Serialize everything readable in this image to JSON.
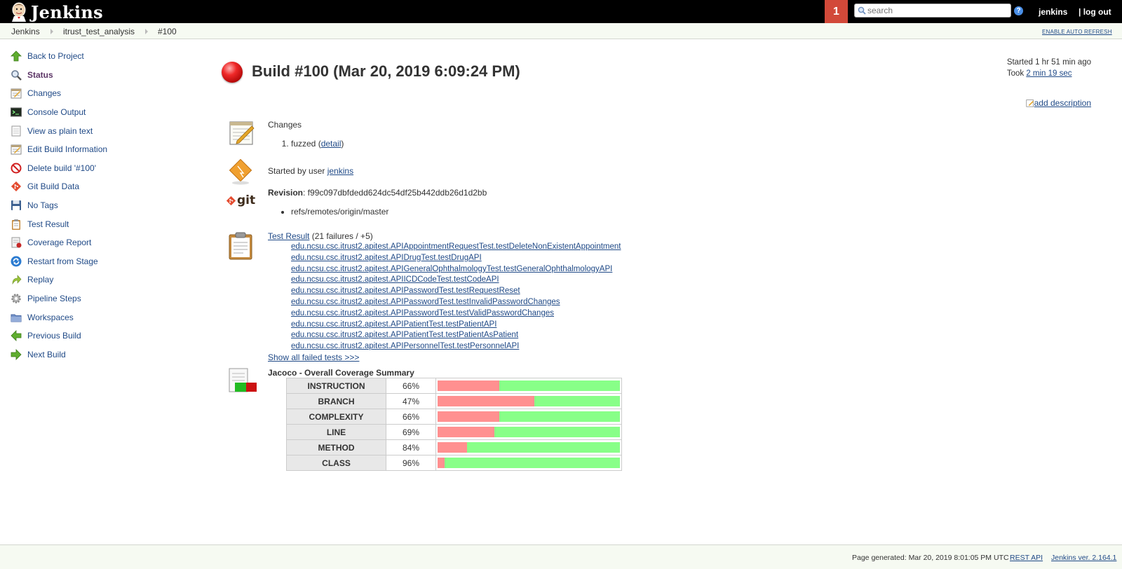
{
  "header": {
    "app_title": "Jenkins",
    "notification_count": "1",
    "search_placeholder": "search",
    "help": "?",
    "user": "jenkins",
    "logout": "| log out"
  },
  "breadcrumb": {
    "items": [
      "Jenkins",
      "itrust_test_analysis",
      "#100"
    ],
    "auto_refresh": "ENABLE AUTO REFRESH"
  },
  "sidebar": {
    "items": [
      {
        "label": "Back to Project",
        "icon": "up-arrow-icon"
      },
      {
        "label": "Status",
        "icon": "magnifier-icon"
      },
      {
        "label": "Changes",
        "icon": "notepad-icon"
      },
      {
        "label": "Console Output",
        "icon": "terminal-icon"
      },
      {
        "label": "View as plain text",
        "icon": "document-icon"
      },
      {
        "label": "Edit Build Information",
        "icon": "notepad-icon"
      },
      {
        "label": "Delete build '#100'",
        "icon": "no-entry-icon"
      },
      {
        "label": "Git Build Data",
        "icon": "git-icon"
      },
      {
        "label": "No Tags",
        "icon": "floppy-icon"
      },
      {
        "label": "Test Result",
        "icon": "clipboard-icon"
      },
      {
        "label": "Coverage Report",
        "icon": "coverage-icon"
      },
      {
        "label": "Restart from Stage",
        "icon": "refresh-icon"
      },
      {
        "label": "Replay",
        "icon": "replay-arrow-icon"
      },
      {
        "label": "Pipeline Steps",
        "icon": "gear-icon"
      },
      {
        "label": "Workspaces",
        "icon": "folder-icon"
      },
      {
        "label": "Previous Build",
        "icon": "left-arrow-icon"
      },
      {
        "label": "Next Build",
        "icon": "right-arrow-icon"
      }
    ]
  },
  "build": {
    "title": "Build #100 (Mar 20, 2019 6:09:24 PM)",
    "status_color": "#ef2929",
    "started": "Started 1 hr 51 min ago",
    "took_prefix": "Took ",
    "took": "2 min 19 sec",
    "add_description": "add description"
  },
  "changes": {
    "heading": "Changes",
    "item_text": "fuzzed (",
    "item_link": "detail",
    "item_suffix": ")"
  },
  "cause": {
    "prefix": "Started by user ",
    "user": "jenkins"
  },
  "git": {
    "logo_text": "git",
    "revision_label": "Revision",
    "revision_value": ": f99c097dbfdedd624dc54df25b442ddb26d1d2bb",
    "branch": "refs/remotes/origin/master"
  },
  "tests": {
    "link": "Test Result",
    "summary": " (21 failures / +5)",
    "failures": [
      "edu.ncsu.csc.itrust2.apitest.APIAppointmentRequestTest.testDeleteNonExistentAppointment",
      "edu.ncsu.csc.itrust2.apitest.APIDrugTest.testDrugAPI",
      "edu.ncsu.csc.itrust2.apitest.APIGeneralOphthalmologyTest.testGeneralOphthalmologyAPI",
      "edu.ncsu.csc.itrust2.apitest.APIICDCodeTest.testCodeAPI",
      "edu.ncsu.csc.itrust2.apitest.APIPasswordTest.testRequestReset",
      "edu.ncsu.csc.itrust2.apitest.APIPasswordTest.testInvalidPasswordChanges",
      "edu.ncsu.csc.itrust2.apitest.APIPasswordTest.testValidPasswordChanges",
      "edu.ncsu.csc.itrust2.apitest.APIPatientTest.testPatientAPI",
      "edu.ncsu.csc.itrust2.apitest.APIPatientTest.testPatientAsPatient",
      "edu.ncsu.csc.itrust2.apitest.APIPersonnelTest.testPersonnelAPI"
    ],
    "show_all": "Show all failed tests >>>"
  },
  "jacoco": {
    "heading": "Jacoco - Overall Coverage Summary",
    "rows": [
      {
        "metric": "INSTRUCTION",
        "percent": "66%",
        "covered": 0.66
      },
      {
        "metric": "BRANCH",
        "percent": "47%",
        "covered": 0.47
      },
      {
        "metric": "COMPLEXITY",
        "percent": "66%",
        "covered": 0.66
      },
      {
        "metric": "LINE",
        "percent": "69%",
        "covered": 0.69
      },
      {
        "metric": "METHOD",
        "percent": "84%",
        "covered": 0.84
      },
      {
        "metric": "CLASS",
        "percent": "96%",
        "covered": 0.96
      }
    ],
    "covered_color": "#88ff88",
    "missed_color": "#ff9090"
  },
  "footer": {
    "generated": "Page generated: Mar 20, 2019 8:01:05 PM UTC",
    "rest_api": "REST API",
    "version": "Jenkins ver. 2.164.1"
  }
}
